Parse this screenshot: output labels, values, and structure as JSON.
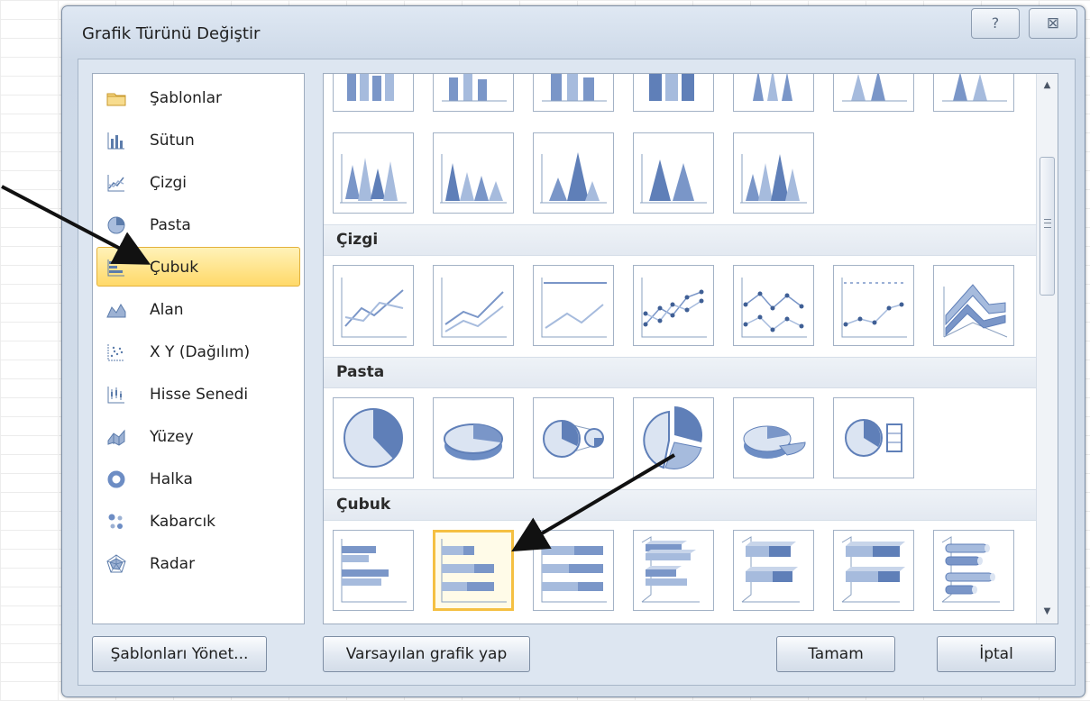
{
  "dialog": {
    "title": "Grafik Türünü Değiştir",
    "help_label": "?",
    "close_label": "⊠"
  },
  "categories": [
    {
      "label": "Şablonlar",
      "icon": "folder-icon"
    },
    {
      "label": "Sütun",
      "icon": "column-chart-icon"
    },
    {
      "label": "Çizgi",
      "icon": "line-chart-icon"
    },
    {
      "label": "Pasta",
      "icon": "pie-chart-icon"
    },
    {
      "label": "Çubuk",
      "icon": "bar-chart-icon",
      "selected": true
    },
    {
      "label": "Alan",
      "icon": "area-chart-icon"
    },
    {
      "label": "X Y (Dağılım)",
      "icon": "scatter-chart-icon"
    },
    {
      "label": "Hisse Senedi",
      "icon": "stock-chart-icon"
    },
    {
      "label": "Yüzey",
      "icon": "surface-chart-icon"
    },
    {
      "label": "Halka",
      "icon": "doughnut-chart-icon"
    },
    {
      "label": "Kabarcık",
      "icon": "bubble-chart-icon"
    },
    {
      "label": "Radar",
      "icon": "radar-chart-icon"
    }
  ],
  "sections": {
    "line": "Çizgi",
    "pie": "Pasta",
    "bar": "Çubuk"
  },
  "buttons": {
    "manage_templates": "Şablonları Yönet...",
    "set_default": "Varsayılan grafik yap",
    "ok": "Tamam",
    "cancel": "İptal"
  },
  "colors": {
    "selection_fill": "#ffd969",
    "selection_border": "#f5c042",
    "chart_blue": "#6d8dc4",
    "dialog_bg": "#d4deea"
  }
}
